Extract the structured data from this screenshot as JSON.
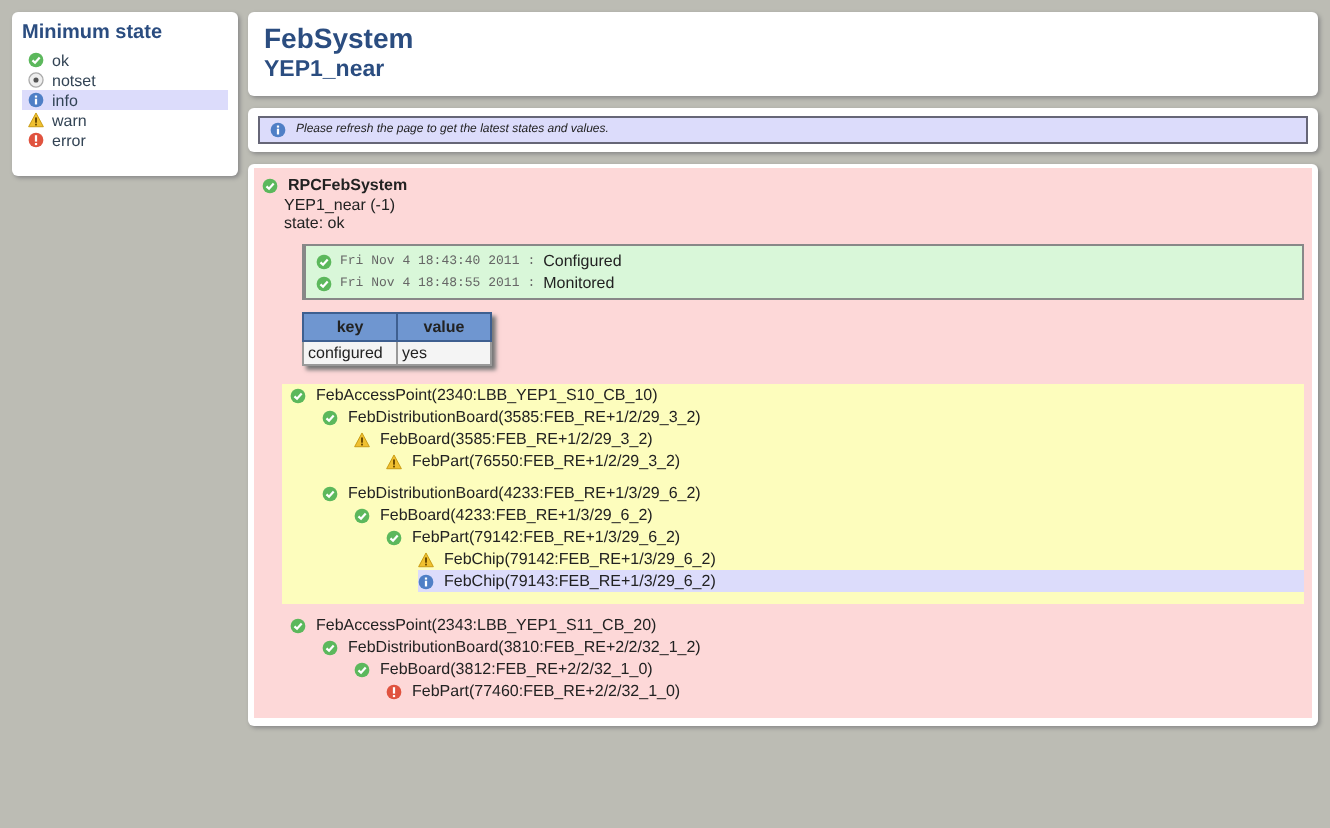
{
  "sidebar": {
    "title": "Minimum state",
    "items": [
      {
        "label": "ok",
        "kind": "ok",
        "selected": false
      },
      {
        "label": "notset",
        "kind": "notset",
        "selected": false
      },
      {
        "label": "info",
        "kind": "info",
        "selected": true
      },
      {
        "label": "warn",
        "kind": "warn",
        "selected": false
      },
      {
        "label": "error",
        "kind": "error",
        "selected": false
      }
    ]
  },
  "header": {
    "title": "FebSystem",
    "subtitle": "YEP1_near"
  },
  "notice": {
    "kind": "info",
    "text": "Please refresh the page to get the latest states and values."
  },
  "system": {
    "kind": "ok",
    "name": "RPCFebSystem",
    "id": "YEP1_near (-1)",
    "status": "state: ok",
    "log": [
      {
        "kind": "ok",
        "time": "Fri Nov 4 18:43:40 2011",
        "sep": ":",
        "message": "Configured"
      },
      {
        "kind": "ok",
        "time": "Fri Nov 4 18:48:55 2011",
        "sep": ":",
        "message": "Monitored"
      }
    ],
    "table": {
      "columns": [
        "key",
        "value"
      ],
      "rows": [
        [
          "configured",
          "yes"
        ]
      ]
    },
    "tree": [
      {
        "label": "FebAccessPoint(2340:LBB_YEP1_S10_CB_10)",
        "kind": "ok",
        "highlighted": true,
        "selected": false,
        "children": [
          {
            "label": "FebDistributionBoard(3585:FEB_RE+1/2/29_3_2)",
            "kind": "ok",
            "selected": false,
            "children": [
              {
                "label": "FebBoard(3585:FEB_RE+1/2/29_3_2)",
                "kind": "warn",
                "selected": false,
                "children": [
                  {
                    "label": "FebPart(76550:FEB_RE+1/2/29_3_2)",
                    "kind": "warn",
                    "selected": false
                  }
                ]
              }
            ]
          },
          {
            "label": "FebDistributionBoard(4233:FEB_RE+1/3/29_6_2)",
            "kind": "ok",
            "selected": false,
            "children": [
              {
                "label": "FebBoard(4233:FEB_RE+1/3/29_6_2)",
                "kind": "ok",
                "selected": false,
                "children": [
                  {
                    "label": "FebPart(79142:FEB_RE+1/3/29_6_2)",
                    "kind": "ok",
                    "selected": false,
                    "children": [
                      {
                        "label": "FebChip(79142:FEB_RE+1/3/29_6_2)",
                        "kind": "warn",
                        "selected": false
                      },
                      {
                        "label": "FebChip(79143:FEB_RE+1/3/29_6_2)",
                        "kind": "info",
                        "selected": true
                      }
                    ]
                  }
                ]
              }
            ]
          }
        ]
      },
      {
        "label": "FebAccessPoint(2343:LBB_YEP1_S11_CB_20)",
        "kind": "ok",
        "highlighted": false,
        "selected": false,
        "children": [
          {
            "label": "FebDistributionBoard(3810:FEB_RE+2/2/32_1_2)",
            "kind": "ok",
            "selected": false,
            "children": [
              {
                "label": "FebBoard(3812:FEB_RE+2/2/32_1_0)",
                "kind": "ok",
                "selected": false,
                "children": [
                  {
                    "label": "FebPart(77460:FEB_RE+2/2/32_1_0)",
                    "kind": "error",
                    "selected": false
                  }
                ]
              }
            ]
          }
        ]
      }
    ]
  }
}
